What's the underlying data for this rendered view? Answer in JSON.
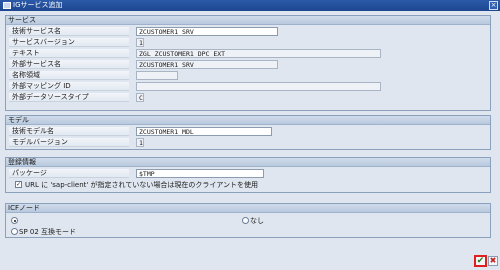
{
  "window": {
    "title": "IGサービス追加"
  },
  "service": {
    "header": "サービス",
    "fields": [
      {
        "label": "技術サービス名",
        "value": "ZCUSTOMER1_SRV"
      },
      {
        "label": "サービスバージョン",
        "value": "1"
      },
      {
        "label": "テキスト",
        "value": "ZGL_ZCUSTOMER1_DPC_EXT"
      },
      {
        "label": "外部サービス名",
        "value": "ZCUSTOMER1_SRV"
      },
      {
        "label": "名称領域",
        "value": ""
      },
      {
        "label": "外部マッピング ID",
        "value": ""
      },
      {
        "label": "外部データソースタイプ",
        "value": "C"
      }
    ]
  },
  "model": {
    "header": "モデル",
    "fields": [
      {
        "label": "技術モデル名",
        "value": "ZCUSTOMER1_MDL"
      },
      {
        "label": "モデルバージョン",
        "value": "1"
      }
    ]
  },
  "registration": {
    "header": "登録情報",
    "package_label": "パッケージ",
    "package_value": "$TMP",
    "checkbox_label": "URL に 'sap-client' が指定されていない場合は現在のクライアントを使用",
    "checkbox_mark": "✓"
  },
  "icf": {
    "header": "ICFノード",
    "option_standard": "",
    "option_none": "なし",
    "option_sp02": "SP 02 互換モード"
  },
  "buttons": {
    "ok_glyph": "✔",
    "cancel_glyph": "✖"
  }
}
